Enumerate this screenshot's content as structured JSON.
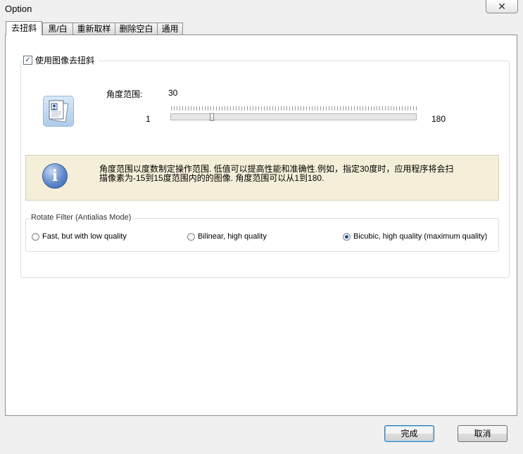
{
  "window": {
    "title": "Option",
    "close_glyph": "✕"
  },
  "tabs": [
    {
      "label": "去扭斜",
      "active": true
    },
    {
      "label": "黑/白"
    },
    {
      "label": "重新取样"
    },
    {
      "label": "删除空白"
    },
    {
      "label": "通用"
    }
  ],
  "deskew": {
    "enable_label": "使用图像去扭斜",
    "enable_checked": true,
    "angle_label": "角度范围:",
    "angle_value": "30",
    "range_min": "1",
    "range_max": "180",
    "slider_value": 30
  },
  "info": {
    "icon": "info-icon",
    "line1": "角度范围以度数制定操作范围. 低值可以提高性能和准确性.例如，指定30度时，应用程序将会扫",
    "line2": "描像素为-15到15度范围内的的图像. 角度范围可以从1到180."
  },
  "rotate_filter": {
    "legend": "Rotate Filter (Antialias Mode)",
    "options": [
      {
        "label": "Fast, but with low quality",
        "checked": false
      },
      {
        "label": "Bilinear, high quality",
        "checked": false
      },
      {
        "label": "Bicubic, high quality (maximum quality)",
        "checked": true
      }
    ]
  },
  "footer": {
    "ok_label": "完成",
    "cancel_label": "取消"
  },
  "colors": {
    "info_bg": "#f5efd9",
    "default_button_border": "#3c7fb1"
  }
}
